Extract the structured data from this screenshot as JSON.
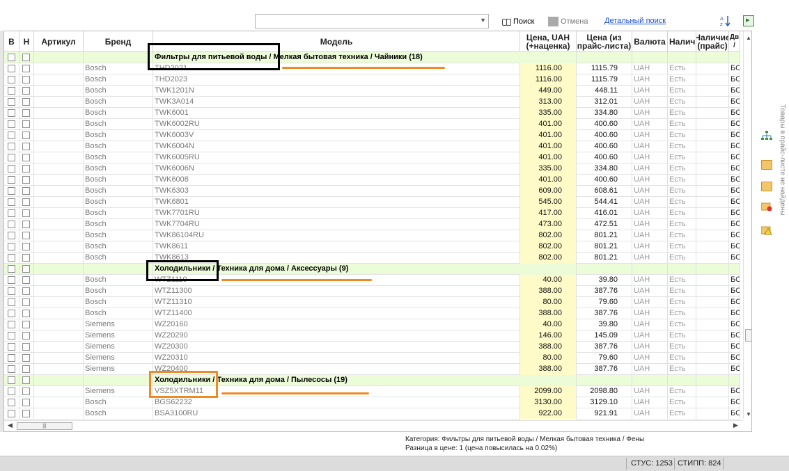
{
  "toolbar": {
    "search_label": "Поиск",
    "cancel_label": "Отмена",
    "detailed_search_label": "Детальный поиск",
    "combo_value": ""
  },
  "columns": {
    "v": "В",
    "n": "Н",
    "article": "Артикул",
    "brand": "Бренд",
    "model": "Модель",
    "price_markup": "Цена, UAH (+наценка)",
    "price_list": "Цена (из прайс-листа)",
    "currency": "Валюта",
    "availability": "Наличи",
    "availability_price": "Наличие (прайс)",
    "extra": "Дв /"
  },
  "rows": [
    {
      "type": "group",
      "label": "Фильтры для питьевой воды / Мелкая бытовая техника / Чайники (18)"
    },
    {
      "type": "item",
      "brand": "Bosch",
      "model": "THD2021",
      "price_markup": "1116.00",
      "price_list": "1115.79",
      "currency": "UAH",
      "availability": "Есть",
      "extra": "БС"
    },
    {
      "type": "item",
      "brand": "Bosch",
      "model": "THD2023",
      "price_markup": "1116.00",
      "price_list": "1115.79",
      "currency": "UAH",
      "availability": "Есть",
      "extra": "БС"
    },
    {
      "type": "item",
      "brand": "Bosch",
      "model": "TWK1201N",
      "price_markup": "449.00",
      "price_list": "448.11",
      "currency": "UAH",
      "availability": "Есть",
      "extra": "БС"
    },
    {
      "type": "item",
      "brand": "Bosch",
      "model": "TWK3A014",
      "price_markup": "313.00",
      "price_list": "312.01",
      "currency": "UAH",
      "availability": "Есть",
      "extra": "БС"
    },
    {
      "type": "item",
      "brand": "Bosch",
      "model": "TWK6001",
      "price_markup": "335.00",
      "price_list": "334.80",
      "currency": "UAH",
      "availability": "Есть",
      "extra": "БС"
    },
    {
      "type": "item",
      "brand": "Bosch",
      "model": "TWK6002RU",
      "price_markup": "401.00",
      "price_list": "400.60",
      "currency": "UAH",
      "availability": "Есть",
      "extra": "БС"
    },
    {
      "type": "item",
      "brand": "Bosch",
      "model": "TWK6003V",
      "price_markup": "401.00",
      "price_list": "400.60",
      "currency": "UAH",
      "availability": "Есть",
      "extra": "БС"
    },
    {
      "type": "item",
      "brand": "Bosch",
      "model": "TWK6004N",
      "price_markup": "401.00",
      "price_list": "400.60",
      "currency": "UAH",
      "availability": "Есть",
      "extra": "БС"
    },
    {
      "type": "item",
      "brand": "Bosch",
      "model": "TWK6005RU",
      "price_markup": "401.00",
      "price_list": "400.60",
      "currency": "UAH",
      "availability": "Есть",
      "extra": "БС"
    },
    {
      "type": "item",
      "brand": "Bosch",
      "model": "TWK6006N",
      "price_markup": "335.00",
      "price_list": "334.80",
      "currency": "UAH",
      "availability": "Есть",
      "extra": "БС"
    },
    {
      "type": "item",
      "brand": "Bosch",
      "model": "TWK6008",
      "price_markup": "401.00",
      "price_list": "400.60",
      "currency": "UAH",
      "availability": "Есть",
      "extra": "БС"
    },
    {
      "type": "item",
      "brand": "Bosch",
      "model": "TWK6303",
      "price_markup": "609.00",
      "price_list": "608.61",
      "currency": "UAH",
      "availability": "Есть",
      "extra": "БС"
    },
    {
      "type": "item",
      "brand": "Bosch",
      "model": "TWK6801",
      "price_markup": "545.00",
      "price_list": "544.41",
      "currency": "UAH",
      "availability": "Есть",
      "extra": "БС"
    },
    {
      "type": "item",
      "brand": "Bosch",
      "model": "TWK7701RU",
      "price_markup": "417.00",
      "price_list": "416.01",
      "currency": "UAH",
      "availability": "Есть",
      "extra": "БС"
    },
    {
      "type": "item",
      "brand": "Bosch",
      "model": "TWK7704RU",
      "price_markup": "473.00",
      "price_list": "472.51",
      "currency": "UAH",
      "availability": "Есть",
      "extra": "БС"
    },
    {
      "type": "item",
      "brand": "Bosch",
      "model": "TWK86104RU",
      "price_markup": "802.00",
      "price_list": "801.21",
      "currency": "UAH",
      "availability": "Есть",
      "extra": "БС"
    },
    {
      "type": "item",
      "brand": "Bosch",
      "model": "TWK8611",
      "price_markup": "802.00",
      "price_list": "801.21",
      "currency": "UAH",
      "availability": "Есть",
      "extra": "БС"
    },
    {
      "type": "item",
      "brand": "Bosch",
      "model": "TWK8613",
      "price_markup": "802.00",
      "price_list": "801.21",
      "currency": "UAH",
      "availability": "Есть",
      "extra": "БС"
    },
    {
      "type": "group",
      "label": "Холодильники / Техника для дома / Аксессуары (9)"
    },
    {
      "type": "item",
      "brand": "Bosch",
      "model": "WTZ1110",
      "price_markup": "40.00",
      "price_list": "39.80",
      "currency": "UAH",
      "availability": "Есть",
      "extra": "БС"
    },
    {
      "type": "item",
      "brand": "Bosch",
      "model": "WTZ11300",
      "price_markup": "388.00",
      "price_list": "387.76",
      "currency": "UAH",
      "availability": "Есть",
      "extra": "БС"
    },
    {
      "type": "item",
      "brand": "Bosch",
      "model": "WTZ11310",
      "price_markup": "80.00",
      "price_list": "79.60",
      "currency": "UAH",
      "availability": "Есть",
      "extra": "БС"
    },
    {
      "type": "item",
      "brand": "Bosch",
      "model": "WTZ11400",
      "price_markup": "388.00",
      "price_list": "387.76",
      "currency": "UAH",
      "availability": "Есть",
      "extra": "БС"
    },
    {
      "type": "item",
      "brand": "Siemens",
      "model": "WZ20160",
      "price_markup": "40.00",
      "price_list": "39.80",
      "currency": "UAH",
      "availability": "Есть",
      "extra": "БС"
    },
    {
      "type": "item",
      "brand": "Siemens",
      "model": "WZ20290",
      "price_markup": "146.00",
      "price_list": "145.09",
      "currency": "UAH",
      "availability": "Есть",
      "extra": "БС"
    },
    {
      "type": "item",
      "brand": "Siemens",
      "model": "WZ20300",
      "price_markup": "388.00",
      "price_list": "387.76",
      "currency": "UAH",
      "availability": "Есть",
      "extra": "БС"
    },
    {
      "type": "item",
      "brand": "Siemens",
      "model": "WZ20310",
      "price_markup": "80.00",
      "price_list": "79.60",
      "currency": "UAH",
      "availability": "Есть",
      "extra": "БС"
    },
    {
      "type": "item",
      "brand": "Siemens",
      "model": "WZ20400",
      "price_markup": "388.00",
      "price_list": "387.76",
      "currency": "UAH",
      "availability": "Есть",
      "extra": "БС"
    },
    {
      "type": "group",
      "label": "Холодильники / Техника для дома / Пылесосы (19)"
    },
    {
      "type": "item",
      "brand": "Siemens",
      "model": "VSZ5XTRM11",
      "price_markup": "2099.00",
      "price_list": "2098.80",
      "currency": "UAH",
      "availability": "Есть",
      "extra": "БС"
    },
    {
      "type": "item",
      "brand": "Bosch",
      "model": "BGS62232",
      "price_markup": "3130.00",
      "price_list": "3129.10",
      "currency": "UAH",
      "availability": "Есть",
      "extra": "БС"
    },
    {
      "type": "item",
      "brand": "Bosch",
      "model": "BSA3100RU",
      "price_markup": "922.00",
      "price_list": "921.91",
      "currency": "UAH",
      "availability": "Есть",
      "extra": "БС"
    }
  ],
  "side_panel": {
    "vertical_text": "Товары в прайс-листе не найдены"
  },
  "info": {
    "category_line": "Категория: Фильтры для питьевой воды / Мелкая бытовая техника / Фены",
    "price_diff_line": "Разница в цене: 1  (цена повысилась на 0.02%)"
  },
  "status": {
    "stus": "СТУС: 1253",
    "stipp": "СТИПП: 824"
  },
  "colors": {
    "group_row_bg": "#ecfcd8",
    "price_col_bg": "#fffbc8",
    "annotation_orange": "#f08a24",
    "annotation_black": "#000000",
    "link": "#1a4fd1"
  }
}
